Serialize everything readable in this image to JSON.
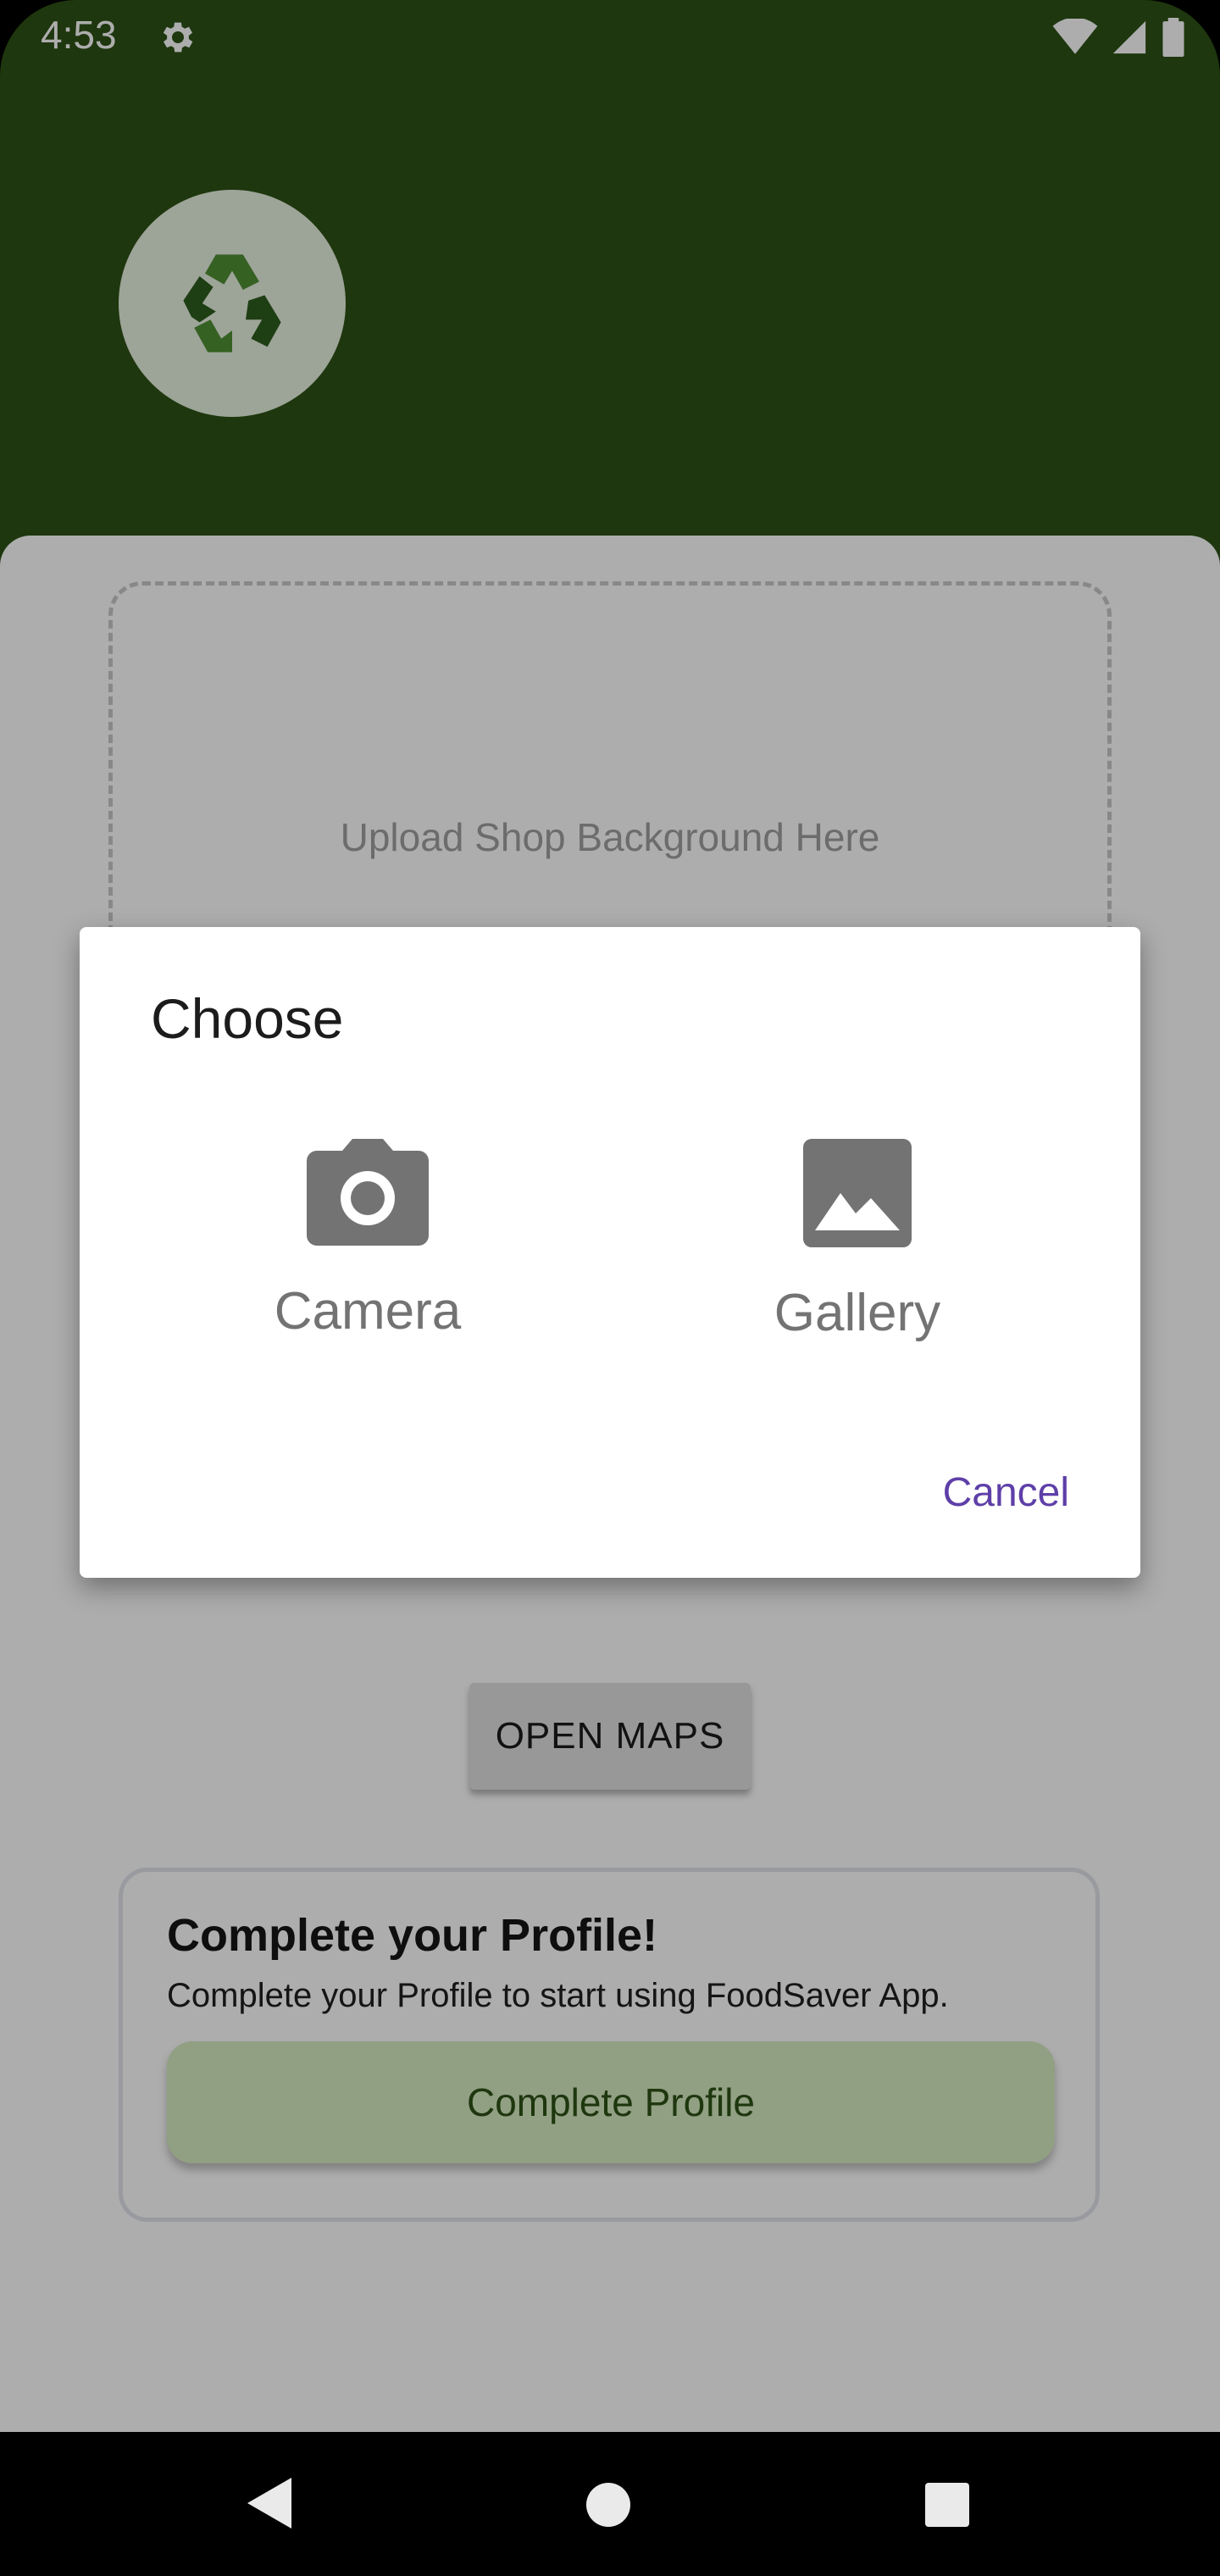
{
  "status_bar": {
    "time": "4:53",
    "icons": [
      "settings-gear-icon",
      "wifi-icon",
      "signal-icon",
      "battery-icon"
    ]
  },
  "header": {
    "logo_icon": "recycle-icon"
  },
  "upload": {
    "label": "Upload Shop Background Here"
  },
  "maps_button": {
    "label": "OPEN MAPS"
  },
  "profile_card": {
    "title": "Complete your Profile!",
    "subtitle": "Complete your Profile to start using FoodSaver App.",
    "button_label": "Complete Profile"
  },
  "dialog": {
    "title": "Choose",
    "options": [
      {
        "label": "Camera",
        "icon": "camera-icon"
      },
      {
        "label": "Gallery",
        "icon": "image-icon"
      }
    ],
    "cancel_label": "Cancel"
  },
  "colors": {
    "header_green": "#2d5116",
    "dialog_accent": "#5e3fa8",
    "button_green_light": "#d6ebc2"
  }
}
